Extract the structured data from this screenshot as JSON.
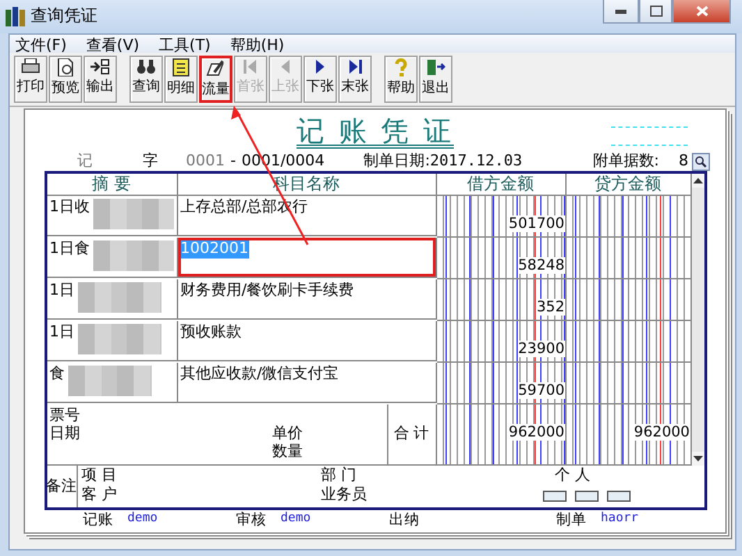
{
  "window": {
    "title": "查询凭证"
  },
  "menu": [
    "文件(F)",
    "查看(V)",
    "工具(T)",
    "帮助(H)"
  ],
  "toolbar": [
    [
      {
        "label": "打印",
        "disabled": false,
        "highlighted": false
      },
      {
        "label": "预览",
        "disabled": false,
        "highlighted": false
      },
      {
        "label": "输出",
        "disabled": false,
        "highlighted": false
      }
    ],
    [
      {
        "label": "查询",
        "disabled": false,
        "highlighted": false
      },
      {
        "label": "明细",
        "disabled": false,
        "highlighted": false
      },
      {
        "label": "流量",
        "disabled": false,
        "highlighted": true
      },
      {
        "label": "首张",
        "disabled": true,
        "highlighted": false
      },
      {
        "label": "上张",
        "disabled": true,
        "highlighted": false
      },
      {
        "label": "下张",
        "disabled": false,
        "highlighted": false
      },
      {
        "label": "末张",
        "disabled": false,
        "highlighted": false
      }
    ],
    [
      {
        "label": "帮助",
        "disabled": false,
        "highlighted": false
      },
      {
        "label": "退出",
        "disabled": false,
        "highlighted": false
      }
    ]
  ],
  "voucher": {
    "title": "记 账 凭 证",
    "type_label": "记",
    "zi": "字",
    "number": "0001",
    "dash": "-",
    "page": "0001/0004",
    "date_label": "制单日期:",
    "date": "2017.12.03",
    "attach_label": "附单据数:",
    "attach_count": "8"
  },
  "table": {
    "columns": [
      "摘 要",
      "科目名称",
      "借方金额",
      "贷方金额"
    ],
    "rows": [
      {
        "summary": "1日收",
        "subject": "上存总部/总部农行",
        "debit": "501700",
        "selected": false,
        "highlighted": false
      },
      {
        "summary": "1日食",
        "subject": "1002001",
        "debit": "58248",
        "selected": true,
        "highlighted": true
      },
      {
        "summary": "1日",
        "subject": "财务费用/餐饮刷卡手续费",
        "debit": "352",
        "selected": false,
        "highlighted": false
      },
      {
        "summary": "1日",
        "subject": "预收账款",
        "debit": "23900",
        "selected": false,
        "highlighted": false
      },
      {
        "summary": "食",
        "subject": "其他应收款/微信支付宝",
        "debit": "59700",
        "selected": false,
        "highlighted": false
      }
    ],
    "ticket_label": "票号",
    "date_label": "日期",
    "price_label": "单价",
    "qty_label": "数量",
    "total_label": "合 计",
    "total_debit": "962000",
    "total_credit": "962000"
  },
  "notes": {
    "label": "备注",
    "project": "项 目",
    "customer": "客 户",
    "dept": "部 门",
    "clerk": "业务员",
    "person": "个 人"
  },
  "signatures": [
    {
      "label": "记账",
      "name": "demo"
    },
    {
      "label": "审核",
      "name": "demo"
    },
    {
      "label": "出纳"
    },
    {
      "label": "制单",
      "name": "haorr"
    }
  ]
}
